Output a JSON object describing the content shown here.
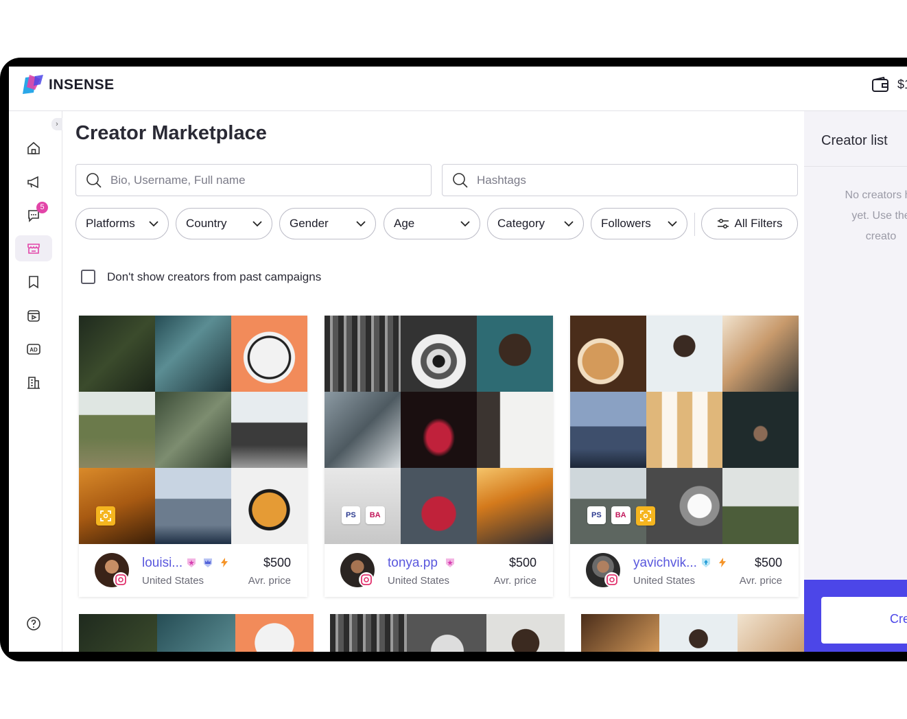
{
  "app": {
    "name": "INSENSE",
    "balance": "$1"
  },
  "sidebar": {
    "items": [
      {
        "icon": "home-icon"
      },
      {
        "icon": "megaphone-icon"
      },
      {
        "icon": "chat-icon",
        "badge": "5"
      },
      {
        "icon": "store-icon",
        "active": true
      },
      {
        "icon": "bookmark-icon"
      },
      {
        "icon": "video-icon"
      },
      {
        "icon": "ad-icon",
        "label": "AD"
      },
      {
        "icon": "building-icon"
      }
    ],
    "help_icon": "help-icon"
  },
  "main": {
    "title": "Creator Marketplace",
    "search_bio_placeholder": "Bio, Username, Full name",
    "search_hashtags_placeholder": "Hashtags",
    "filters": {
      "platforms": "Platforms",
      "country": "Country",
      "gender": "Gender",
      "age": "Age",
      "category": "Category",
      "followers": "Followers",
      "all_filters": "All Filters"
    },
    "exclude_past_label": "Don't show creators from past campaigns"
  },
  "creators": [
    {
      "username": "louisi...",
      "country": "United States",
      "price": "$500",
      "price_label": "Avr. price"
    },
    {
      "username": "tonya.pp",
      "country": "United States",
      "price": "$500",
      "price_label": "Avr. price"
    },
    {
      "username": "yavichvik...",
      "country": "United States",
      "price": "$500",
      "price_label": "Avr. price"
    }
  ],
  "badges": {
    "ps": "PS",
    "ba": "BA"
  },
  "creator_list": {
    "title": "Creator list",
    "empty_line1": "No creators ha",
    "empty_line2": "yet. Use the",
    "empty_line3": "creato",
    "button": "Cre"
  },
  "colors": {
    "accent": "#4c46e8",
    "username": "#5957dd",
    "badge": "#e245a8",
    "gold": "#f5b51f"
  }
}
